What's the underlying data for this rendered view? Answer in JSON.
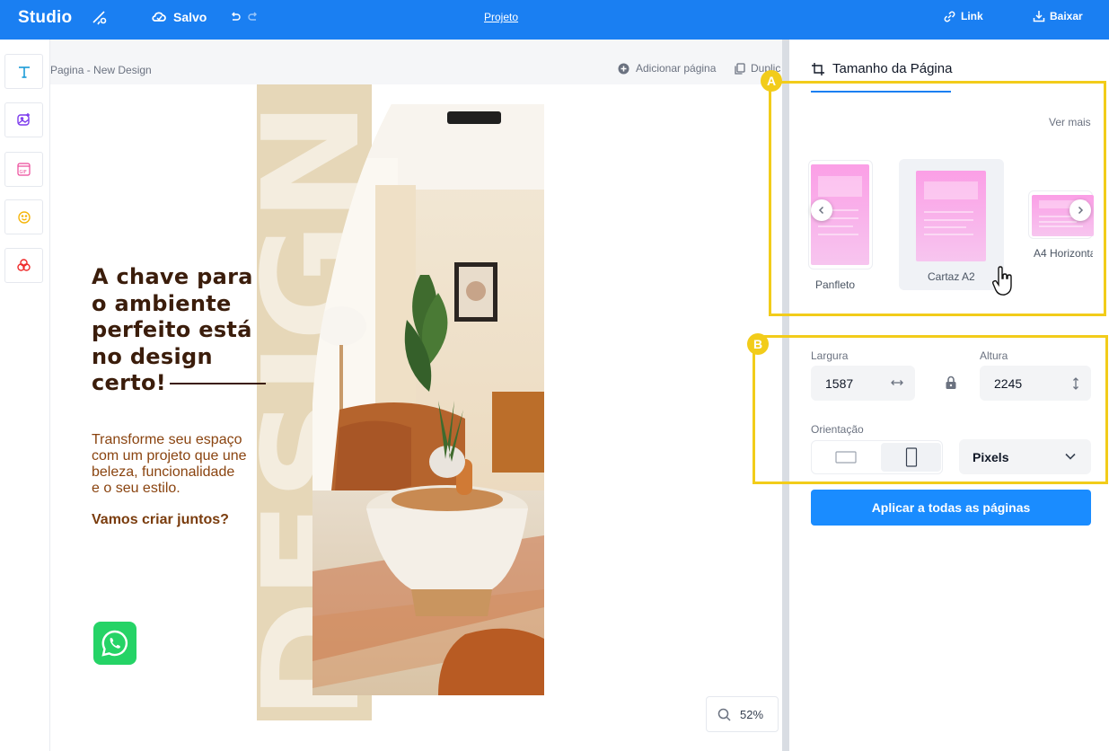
{
  "topbar": {
    "brand": "Studio",
    "saved_label": "Salvo",
    "project_label": "Projeto",
    "link_label": "Link",
    "download_label": "Baixar"
  },
  "canvas": {
    "page_name": "Pagina - New Design",
    "add_page_label": "Adicionar página",
    "duplicate_label": "Duplic",
    "zoom_level": "52%"
  },
  "design": {
    "headline": [
      "A chave para",
      "o ambiente",
      "perfeito está",
      "no design",
      "certo!"
    ],
    "body": [
      "Transforme seu espaço",
      "com um projeto que une",
      "beleza, funcionalidade",
      "e o seu estilo."
    ],
    "cta": "Vamos criar juntos?",
    "vertical_word": "DESIGN"
  },
  "panel": {
    "title": "Tamanho da Página",
    "see_more": "Ver mais",
    "sizes": [
      {
        "label": "Panfleto"
      },
      {
        "label": "Cartaz A2",
        "selected": true
      },
      {
        "label": "A4 Horizonta"
      }
    ],
    "width_label": "Largura",
    "width_value": "1587",
    "height_label": "Altura",
    "height_value": "2245",
    "orientation_label": "Orientação",
    "orientation_selected": "portrait",
    "units_value": "Pixels",
    "apply_label": "Aplicar a todas as páginas"
  },
  "annotations": {
    "a": "A",
    "b": "B"
  },
  "colors": {
    "accent": "#1a7ff2",
    "highlight": "#f2cc1a",
    "headline": "#3b1d0b",
    "body_text": "#8a4410",
    "beige": "#e6d7b8"
  },
  "icons": {
    "left_tools": [
      "text-icon",
      "image-icon",
      "gif-icon",
      "emoji-icon",
      "shapes-icon"
    ]
  }
}
